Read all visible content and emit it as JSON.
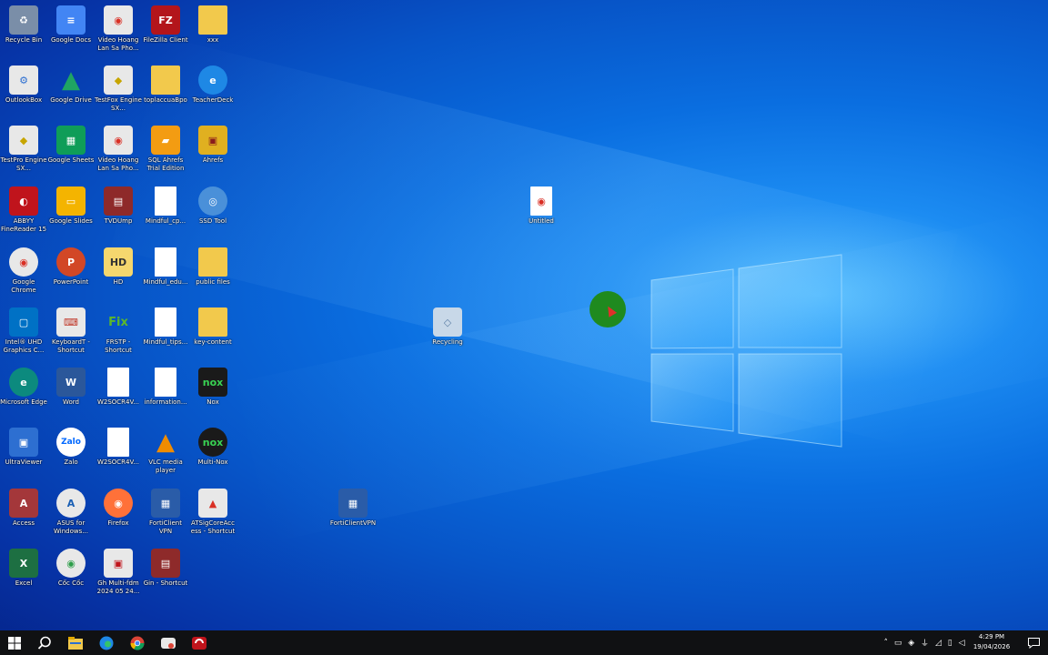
{
  "desktop": {
    "icons": [
      {
        "label": "Recycle Bin",
        "glyph": "♻",
        "color": "#7a8ea8"
      },
      {
        "label": "Google Docs",
        "glyph": "≡",
        "color": "#4285f4"
      },
      {
        "label": "Video Hoang Lan Sa Pho...",
        "glyph": "◉",
        "color": "#e8e8e8"
      },
      {
        "label": "FileZilla Client",
        "glyph": "FZ",
        "color": "#b3151b"
      },
      {
        "label": "xxx",
        "glyph": "",
        "color": "#f2c94c"
      },
      {
        "label": "OutlookBox",
        "glyph": "⚙",
        "color": "#e8e8e8"
      },
      {
        "label": "Google Drive",
        "glyph": "▲",
        "color": "#1fa463"
      },
      {
        "label": "TestFox Engine SX...",
        "glyph": "◆",
        "color": "#e8e8e8"
      },
      {
        "label": "toplaccuaBpo",
        "glyph": "",
        "color": "#f2c94c"
      },
      {
        "label": "TeacherDeck",
        "glyph": "e",
        "color": "#1e88e5"
      },
      {
        "label": "TestPro Engine SX...",
        "glyph": "◆",
        "color": "#e8e8e8"
      },
      {
        "label": "Google Sheets",
        "glyph": "▦",
        "color": "#0f9d58"
      },
      {
        "label": "Video Hoang Lan Sa Pho...",
        "glyph": "◉",
        "color": "#e8e8e8"
      },
      {
        "label": "SQL Ahrefs Trial Edition",
        "glyph": "▰",
        "color": "#f39c12"
      },
      {
        "label": "Ahrefs",
        "glyph": "▣",
        "color": "#e0b020"
      },
      {
        "label": "ABBYY FineReader 15",
        "glyph": "◐",
        "color": "#c0141c"
      },
      {
        "label": "Google Slides",
        "glyph": "▭",
        "color": "#f4b400"
      },
      {
        "label": "TVDUmp",
        "glyph": "▤",
        "color": "#8e2a2a"
      },
      {
        "label": "Mindful_cp...",
        "glyph": "",
        "color": "#ffffff"
      },
      {
        "label": "SSD Tool",
        "glyph": "◎",
        "color": "#4a90d9"
      },
      {
        "label": "Google Chrome",
        "glyph": "◉",
        "color": "#e8e8e8"
      },
      {
        "label": "PowerPoint",
        "glyph": "P",
        "color": "#d24726"
      },
      {
        "label": "HD",
        "glyph": "HD",
        "color": "#f5d76e"
      },
      {
        "label": "Mindful_edu...",
        "glyph": "",
        "color": "#ffffff"
      },
      {
        "label": "public files",
        "glyph": "",
        "color": "#f2c94c"
      },
      {
        "label": "Intel® UHD Graphics C...",
        "glyph": "▢",
        "color": "#0071c5"
      },
      {
        "label": "KeyboardT - Shortcut",
        "glyph": "⌨",
        "color": "#e8e8e8"
      },
      {
        "label": "FRSTP - Shortcut",
        "glyph": "Fix",
        "color": "#3f8a2a"
      },
      {
        "label": "Mindful_tips...",
        "glyph": "",
        "color": "#ffffff"
      },
      {
        "label": "key-content",
        "glyph": "",
        "color": "#f2c94c"
      },
      {
        "label": "Microsoft Edge",
        "glyph": "e",
        "color": "#0c8a7e"
      },
      {
        "label": "Word",
        "glyph": "W",
        "color": "#2b579a"
      },
      {
        "label": "W2SOCR4V...",
        "glyph": "",
        "color": "#ffffff"
      },
      {
        "label": "information...",
        "glyph": "",
        "color": "#ffffff"
      },
      {
        "label": "Nox",
        "glyph": "nox",
        "color": "#1a1a1a"
      },
      {
        "label": "UltraViewer",
        "glyph": "▣",
        "color": "#2d6fd1"
      },
      {
        "label": "Zalo",
        "glyph": "Zalo",
        "color": "#0068ff"
      },
      {
        "label": "W2SOCR4V...",
        "glyph": "",
        "color": "#ffffff"
      },
      {
        "label": "VLC media player",
        "glyph": "▲",
        "color": "#f08c00"
      },
      {
        "label": "Multi-Nox",
        "glyph": "nox",
        "color": "#1a1a1a"
      },
      {
        "label": "Access",
        "glyph": "A",
        "color": "#a4373a"
      },
      {
        "label": "ASUS for Windows...",
        "glyph": "A",
        "color": "#e8e8e8"
      },
      {
        "label": "Firefox",
        "glyph": "◉",
        "color": "#ff7139"
      },
      {
        "label": "FortiClient VPN",
        "glyph": "▦",
        "color": "#2a5ca8"
      },
      {
        "label": "ATSigCoreAccess - Shortcut",
        "glyph": "▲",
        "color": "#e8e8e8"
      },
      {
        "label": "Excel",
        "glyph": "X",
        "color": "#1d6f42"
      },
      {
        "label": "Cốc Cốc",
        "glyph": "◉",
        "color": "#e8e8e8"
      },
      {
        "label": "Gh Multi-fdm 2024 05 24...",
        "glyph": "▣",
        "color": "#e8e8e8"
      },
      {
        "label": "Gin - Shortcut",
        "glyph": "▤",
        "color": "#8e2a2a"
      },
      {
        "label": "Untitled",
        "glyph": "◉",
        "color": "#e8e8e8"
      },
      {
        "label": "Recycling",
        "glyph": "◇",
        "color": "#c8d8e8"
      },
      {
        "label": "FortiClientVPN",
        "glyph": "▦",
        "color": "#2a5ca8"
      }
    ]
  },
  "taskbar": {
    "start": "start-icon",
    "search": "search-icon",
    "apps": [
      "file-explorer-icon",
      "edge-icon",
      "chrome-icon",
      "coccoc-icon",
      "abbyy-icon"
    ],
    "clock": {
      "time": "4:29 PM",
      "date": "19/04/2026"
    }
  }
}
